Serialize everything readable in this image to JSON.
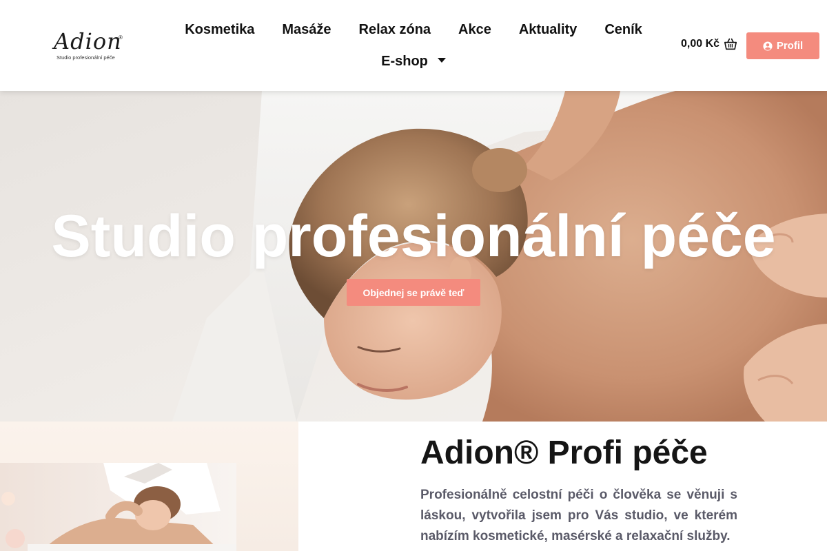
{
  "brand": {
    "logo_word": "Adion",
    "logo_reg": "®",
    "logo_tagline": "Studio profesionální péče"
  },
  "nav": {
    "items": [
      "Kosmetika",
      "Masáže",
      "Relax zóna",
      "Akce",
      "Aktuality",
      "Ceník"
    ],
    "eshop_label": "E-shop"
  },
  "cart": {
    "price": "0,00 Kč",
    "icon": "basket-icon"
  },
  "profile": {
    "label": "Profil",
    "icon": "user-circle-icon"
  },
  "hero": {
    "title": "Studio profesionální péče",
    "cta_label": "Objednej se právě teď"
  },
  "section": {
    "title": "Adion® Profi péče",
    "text": "Profesionálně celostní péči o člověka se věnuji s láskou, vytvořila jsem pro Vás studio, ve kterém nabízím kosmetické, masérské a relaxační služby."
  },
  "colors": {
    "accent": "#f48b7e",
    "text_dark": "#151515",
    "text_body": "#5a5a68"
  }
}
